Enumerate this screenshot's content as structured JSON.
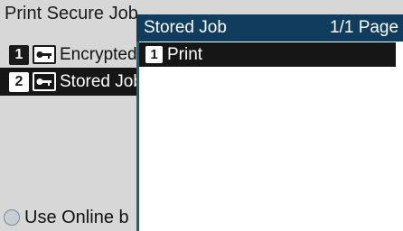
{
  "background": {
    "title": "Print Secure Job",
    "rows": [
      {
        "number": "1",
        "icon": "key-icon",
        "label": "Encrypted Job"
      },
      {
        "number": "2",
        "icon": "key-icon",
        "label": "Stored Job"
      }
    ],
    "bottom_option": "Use Online b"
  },
  "popup": {
    "title": "Stored Job",
    "page_indicator": "1/1 Page",
    "items": [
      {
        "number": "1",
        "label": "Print"
      }
    ]
  }
}
